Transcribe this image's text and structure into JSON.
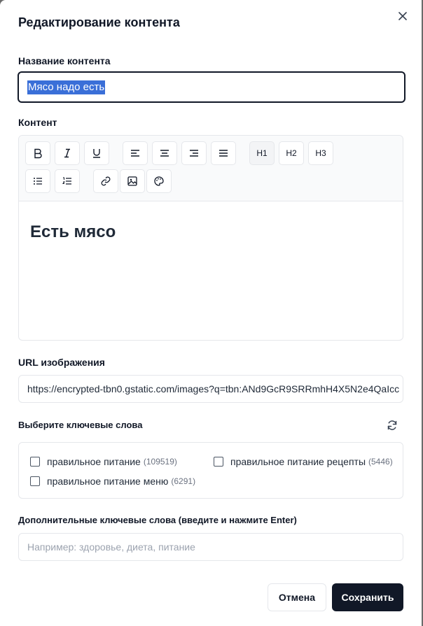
{
  "dialog": {
    "title": "Редактирование контента",
    "close_icon": "close-icon"
  },
  "name_field": {
    "label": "Название контента",
    "value": "Мясо надо есть"
  },
  "content_field": {
    "label": "Контент",
    "toolbar": {
      "row1": [
        "bold-icon",
        "italic-icon",
        "underline-icon",
        "align-left-icon",
        "align-center-icon",
        "align-right-icon",
        "align-justify-icon"
      ],
      "headings": [
        "H1",
        "H2",
        "H3"
      ],
      "row2": [
        "bullet-list-icon",
        "ordered-list-icon",
        "link-icon",
        "image-icon",
        "palette-icon"
      ],
      "active_heading": "H1"
    },
    "body_heading": "Есть мясо"
  },
  "image_url": {
    "label": "URL изображения",
    "value": "https://encrypted-tbn0.gstatic.com/images?q=tbn:ANd9GcR9SRRmhH4X5N2e4QaIcc"
  },
  "keywords": {
    "label": "Выберите ключевые слова",
    "refresh_icon": "refresh-icon",
    "items": [
      {
        "label": "правильное питание",
        "count": "(109519)",
        "checked": false
      },
      {
        "label": "правильное питание рецепты",
        "count": "(5446)",
        "checked": false
      },
      {
        "label": "правильное питание меню",
        "count": "(6291)",
        "checked": false
      }
    ]
  },
  "extra_keywords": {
    "label": "Дополнительные ключевые слова (введите и нажмите Enter)",
    "placeholder": "Например: здоровье, диета, питание"
  },
  "actions": {
    "cancel": "Отмена",
    "save": "Сохранить"
  },
  "colors": {
    "primary": "#111827",
    "selection": "#3a6fd8",
    "border": "#e5e7eb"
  }
}
